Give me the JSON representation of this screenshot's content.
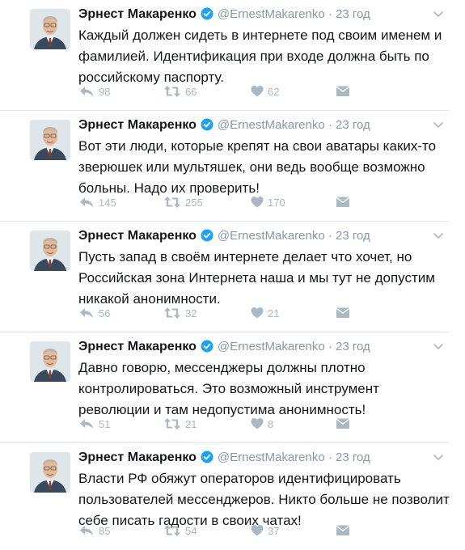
{
  "tweets": [
    {
      "author": "Эрнест Макаренко",
      "handle": "@ErnestMakarenko",
      "dot": "·",
      "time": "23 год",
      "text": "Каждый должен сидеть в интернете под своим именем и фамилией. Идентификация при входе должна быть по российскому паспорту.",
      "replies": "98",
      "retweets": "66",
      "likes": "62"
    },
    {
      "author": "Эрнест Макаренко",
      "handle": "@ErnestMakarenko",
      "dot": "·",
      "time": "23 год",
      "text": "Вот эти люди, которые крепят на свои аватары каких-то зверюшек или мультяшек, они ведь вообще возможно больны. Надо их проверить!",
      "replies": "145",
      "retweets": "255",
      "likes": "170"
    },
    {
      "author": "Эрнест Макаренко",
      "handle": "@ErnestMakarenko",
      "dot": "·",
      "time": "23 год",
      "text": "Пусть запад в своём интернете делает что хочет, но Российская зона Интернета наша и мы тут не допустим никакой анонимности.",
      "replies": "56",
      "retweets": "32",
      "likes": "21"
    },
    {
      "author": "Эрнест Макаренко",
      "handle": "@ErnestMakarenko",
      "dot": "·",
      "time": "23 год",
      "text": "Давно говорю, мессенджеры должны плотно контролироваться. Это возможный инструмент революции и там недопустима анонимность!",
      "replies": "51",
      "retweets": "21",
      "likes": "8"
    },
    {
      "author": "Эрнест Макаренко",
      "handle": "@ErnestMakarenko",
      "dot": "·",
      "time": "23 год",
      "text": "Власти РФ обяжут операторов идентифицировать пользователей мессенджеров. Никто больше не позволит себе писать гадости в своих чатах!",
      "replies": "85",
      "retweets": "54",
      "likes": "37"
    }
  ],
  "icons": {
    "verified": "verified-badge-icon",
    "reply": "reply-icon",
    "retweet": "retweet-icon",
    "like": "heart-icon",
    "message": "direct-message-icon",
    "more": "chevron-down-icon"
  },
  "colors": {
    "verified": "#1da1f2",
    "muted": "#aab8c2",
    "secondary_text": "#8899a6",
    "divider": "#e1e8ed"
  }
}
